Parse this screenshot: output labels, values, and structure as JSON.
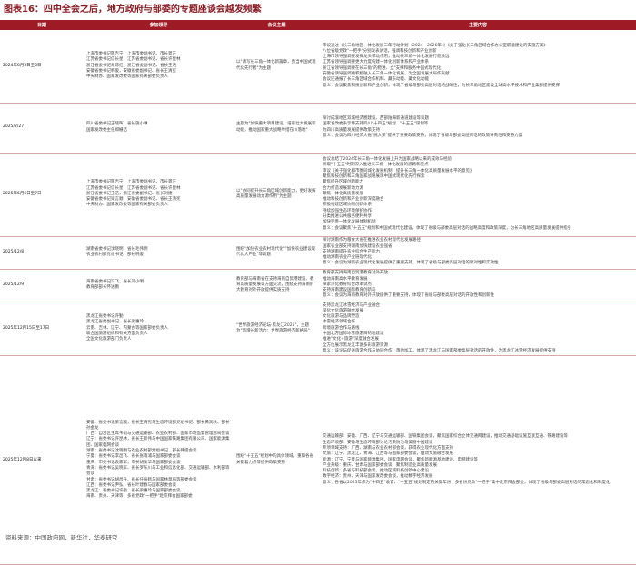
{
  "title": "图表16：四中全会之后，地方政府与部委的专题座谈会越发频繁",
  "columns": [
    "日期",
    "参加领导",
    "会议主题",
    "主要内容"
  ],
  "rows": [
    {
      "date": "2024年6月5日至6日",
      "participants": "上海市委书记陈吉宁，上海市委副书记、市长龚正\n江苏省委书记信长星，江苏省委副书记、省长许昆林\n浙江省委书记易炼红，浙江省委副书记、省长王浩\n安徽省委书记韩俊，安徽省委副书记、省长王清宪\n中央财办、国家发改委等国家有关部委负责人",
      "theme": "以\"请写长三角一体化新篇章，勇当中国式现代化先行者\"为主题",
      "content": [
        "审议通过《长三角地区一体化发展三年行动计划（2024—2026年）》《关于强化长三角区域合作办公室职能建设的实施方案》",
        "八位省级党政\"一把手\"分别发表讲话，强调科技创新和产业创新",
        "上海市领导强调要发挥龙头带动作用，推动长三角一体化发展行稳致远",
        "江苏省领导强调要更大力度构建一体化创新体系和产业体系",
        "浙江省领导强调要在长三角\"的稳进、立\"支撑和服务中国式现代化",
        "安徽省领导强调要积极融入长三角一体化发展，为全国发展大局作贡献",
        "会议还通报了长三角区域合作机制、藏东动能、藏文化动能",
        "意义：会议聚焦科技创新和产业创新，体现了省级与部委高层对话的战略性，为长三角地区建设全球高水平技术和产业集群提供支撑"
      ]
    },
    {
      "date": "2025/2/27",
      "participants": "四川省委书记王晓晖，省长施小琳\n国家发改委主任郑栅洁",
      "theme": "主题为\"加快重大项目建设，培育壮大发展新动能，推动国家重大战略举措在川落地\"",
      "content": [
        "探讨成渝地区双城经济圈建设、西部陆海新通道建设等议题",
        "国家发改委表示将支持四川\"十四五\"规划、\"十五五\"谋划等",
        "为四川高质量发展提供政策支持",
        "意义：会议为四川经济大省\"挑大梁\"提供了重要政策支持，体现了省级与部委高层对话的政策导向性和支持力度"
      ]
    },
    {
      "date": "2025年6月6日至7日",
      "participants": "上海市委书记陈吉宁，上海市委副书记、市长龚正\n江苏省委书记信长星，江苏省委副书记、省长许昆林\n浙江省委书记王浩，浙江省委副书记、省长刘捷\n安徽省委书记梁言顺，安徽省委副书记、省长王清宪\n中央财办、国家发改委等国家有关部委负责人",
      "theme": "以\"协同提升长三角区域创新能力，更好发挥高质量发展动力源作用\"为主题",
      "content": [
        "会议总结了2024年长三角一体化发展上升为国家战略以来的成效与经验",
        "听取\"十五五\"时期深入推进长三角一体化发展的思路和重点",
        "审议《关于强化都市圈同城化发展机制，提升长三角一体化高质量发展水平的意见》",
        "聚焦科技创新和三角国家战略展现中国式现代化先行探索",
        "聚焦提升区域创新能力",
        "合力打造发展新动力源",
        "聚焦一体化高质量发展",
        "推动科技创新和产业创新深度融合",
        "积极构建区域协同创新体系",
        "持续加强生态环境保护协作",
        "分类推进公共服务便利共享",
        "加快完善一体化发展体制机制",
        "意义：会议聚焦\"十五五\"规划和中国式现代化建设，体现了省级与部委高层对话的战略高度和政策深度，为长三角地区高质量发展提供指引"
      ]
    },
    {
      "date": "2025/12/8",
      "participants": "湖南省委书记沈晓明，省长毛伟明\n农业农村部党组书记、部长韩俊",
      "theme": "围绕\"加快农业农村现代化\"\"加快农业建设现代化大产业\"等议题",
      "content": [
        "探讨湖南作为粮食大省在推进农业农村现代化发展路径",
        "国家农业部支持湖南加快建设农业强省",
        "支持湖南提升农业综合生产能力",
        "推动湖南农业产业链现代化",
        "意义：会议为湖南农业现代化发展提供了重要支持，体现了省级与部委高层对话的针对性和实效性"
      ]
    },
    {
      "date": "2025/12/9",
      "participants": "海南省委书记冯飞，省长刘小明\n教育部部长怀进鹏",
      "theme": "教育部与海南省在支持海南自贸港建设、教育高质量发展等方面交流，围绕支持海南扩大教育对外开放提供实质支持",
      "content": [
        "教育部支持海南自贸港教育对外开放",
        "推动海南高水平教育发展",
        "探索深化教育综合改革试点",
        "支持海南建设国际教育创新岛",
        "意义：会议为海南教育对外开放提供了重要支持，体现了省级与部委高层对话的开放性和创新性"
      ]
    },
    {
      "date": "2025年12月15日至17日",
      "participants": "黑龙江省委书记许勤\n黑龙江省委副书记、省长梁惠玲\n云南、吉林、辽宁、内蒙古等国家部委负责人\n联合国旅游组织和有关方面负责人\n全国文化旅游部门负责人",
      "theme": "\"世界旅游经济论坛·黑龙江2025\"，主题为\"新增长新活力：世界旅游经济新格局\"",
      "content": [
        "支持黑龙江冰雪经济与产业融合",
        "深化文化旅游融合发展",
        "文化旅游与品牌塑造",
        "冰雪经济领域合作",
        "跨境旅游合作与路线",
        "中国北方国际冰雪旅游目的地建设",
        "推进\"文化+旅游\"深度融合发展",
        "全方位展示黑龙江丰富多彩旅游资源",
        "意义：该论坛促进旅游合作与协同合作，落地加工，体现了黑龙江与国家部委高层对话的开放性，为黑龙江冰雪经济发展提供支持"
      ]
    },
    {
      "date": "2025年12月8日以来",
      "participants": "安徽：省委书记梁言顺，省长王清宪与生态环境部党组书记、部长黄润秋、部长孙金龙\n广西：自治区主席韦韬与交通运输部、农业农村部、国家市场监督管理总局会谈\n辽宁：省委书记许昆林，省长王新伟与中国国家铁路集团有限公司、国家能源集团、国家电网会谈\n湖南：省委书记沈晓明与农业农村部党组书记、部长韩俊会谈\n宁夏：省委书记李邑飞、省长张雨浦与国家部委会谈\n重庆：市委书记袁家军，市长胡衡华与国家部委会谈\n青海：省委书记吴晓军、省长罗东川与工业和信息化部、交通运输部、水利部等会谈\n甘肃：省委书记胡昌升、省长任振鹤与国家林草局等部委会谈\n江西：省委书记尹弘、省长叶建春与国家部委会谈\n黑龙江：省委书记许勤、省长梁惠玲与国家部委会谈\n海南、贵州、天津等：多省党政\"一把手\"赴京拜会国家部委",
      "theme": "围绕\"十五五\"规划中的具体领域，重和各省关键着力点等提供政策支持",
      "content": [
        "交通运输部：安徽、广西、辽宁与交通运输部、国铁集团会谈，聚焦国家综合立体交通网建设，推动交通基础设施互联互通、铁路建设等",
        "生态环境部：安徽与生态环境部讨论污染防治与美丽中国建设",
        "专项领域支持：广西、湖南与农业农村部会谈，获得农业现代化方面支持",
        "文旅：辽宁、黑龙江、青海、江西等与国家部委会谈，推动文旅融合发展",
        "能源：辽宁、宁夏与国家能源集团、国家电网会谈，聚焦新能源基地建设、电网建设等",
        "产业升级：重庆、甘肃与国家部委会谈，聚焦制造业高质量发展",
        "科技创新：多省与科技部会谈，推动区域科技创新中心建设",
        "数字经济：贵州、天津与国家发改委会谈，推动数字经济发展",
        "意义：各省以2025年作为\"十四五\"收官、\"十五五\"规划制定的关键年份，多省份党政\"一把手\"集中赴京拜会部委，体现了省级与部委高层对话的常态化和制度化"
      ]
    }
  ],
  "source": "资料来源：中国政府网，新华社，华泰研究"
}
